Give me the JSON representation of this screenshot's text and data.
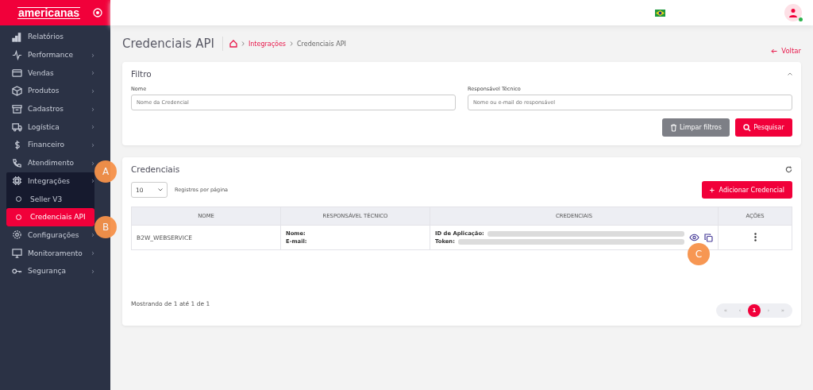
{
  "brand": {
    "logo": "americanas"
  },
  "sidebar": {
    "items": [
      {
        "label": "Relatórios",
        "expanded": false
      },
      {
        "label": "Performance",
        "chevron": "›",
        "expanded": false
      },
      {
        "label": "Vendas",
        "chevron": "›",
        "expanded": false
      },
      {
        "label": "Produtos",
        "chevron": "›",
        "expanded": false
      },
      {
        "label": "Cadastros",
        "chevron": "›",
        "expanded": false
      },
      {
        "label": "Logística",
        "chevron": "›",
        "expanded": false
      },
      {
        "label": "Financeiro",
        "chevron": "›",
        "expanded": false
      },
      {
        "label": "Atendimento",
        "chevron": "›",
        "expanded": false
      },
      {
        "label": "Integrações",
        "chevron": "›",
        "expanded": true,
        "children": [
          {
            "label": "Seller V3",
            "selected": false
          },
          {
            "label": "Credenciais API",
            "selected": true
          }
        ]
      },
      {
        "label": "Configurações",
        "chevron": "›",
        "expanded": false
      },
      {
        "label": "Monitoramento",
        "chevron": "›",
        "expanded": false
      },
      {
        "label": "Segurança",
        "chevron": "›",
        "expanded": false
      }
    ]
  },
  "page": {
    "title": "Credenciais API",
    "breadcrumb": [
      {
        "label": "Integrações",
        "link": true
      },
      {
        "label": "Credenciais API",
        "link": false
      }
    ],
    "back": "Voltar"
  },
  "filter": {
    "title": "Filtro",
    "fields": [
      {
        "label": "Nome",
        "placeholder": "Nome da Credencial"
      },
      {
        "label": "Responsável Técnico",
        "placeholder": "Nome ou e-mail do responsável"
      }
    ],
    "clear_button": "Limpar filtros",
    "search_button": "Pesquisar"
  },
  "credentials": {
    "title": "Credenciais",
    "page_size": "10",
    "page_size_label": "Registros por página",
    "add_button": "Adicionar Credencial",
    "table": {
      "columns": [
        "NOME",
        "RESPONSÁVEL TÉCNICO",
        "CREDENCIAIS",
        "AÇÕES"
      ],
      "rows": [
        {
          "name": "B2W_WEBSERVICE",
          "owner_labels": [
            "Nome:",
            "E-mail:"
          ],
          "credential_labels": [
            "ID de Aplicação:",
            "Token:"
          ]
        }
      ]
    },
    "summary": "Mostrando de 1 até 1 de 1",
    "pagination": [
      {
        "label": "«",
        "selected": false
      },
      {
        "label": "‹",
        "selected": false
      },
      {
        "label": "1",
        "selected": true
      },
      {
        "label": "›",
        "selected": false
      },
      {
        "label": "»",
        "selected": false
      }
    ]
  },
  "callouts": [
    {
      "label": "A"
    },
    {
      "label": "B"
    },
    {
      "label": "C"
    }
  ]
}
